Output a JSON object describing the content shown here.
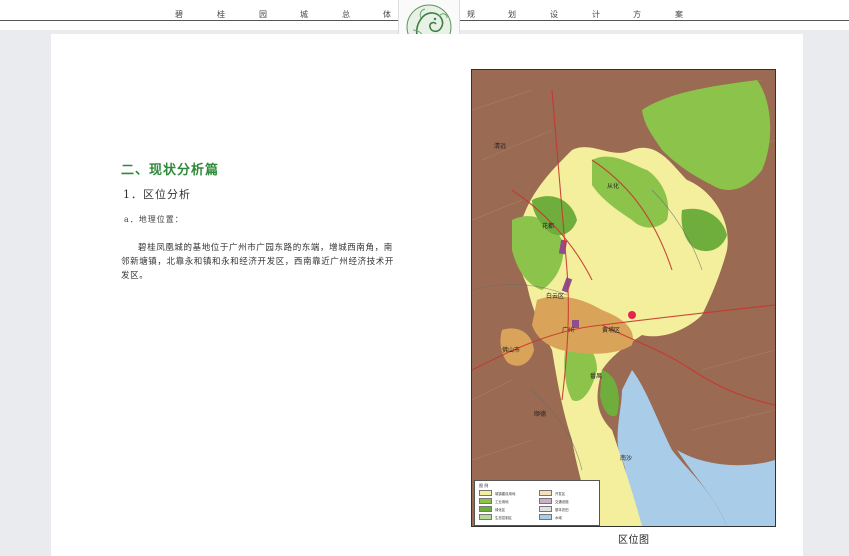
{
  "header": {
    "chars": [
      "碧",
      "桂",
      "园",
      "城",
      "总",
      "体",
      "规",
      "划",
      "设",
      "计",
      "方",
      "案"
    ],
    "emblem": "phoenix-emblem"
  },
  "content": {
    "section_title": "二、现状分析篇",
    "subsection": "1．区位分析",
    "item": "a．地理位置：",
    "paragraph": "碧桂凤凰城的基地位于广州市广园东路的东端，增城西南角，南邻新塘镇，北靠永和镇和永和经济开发区，西南靠近广州经济技术开发区。"
  },
  "map": {
    "caption": "区位图",
    "labels": [
      "清远",
      "从化",
      "花都",
      "白云区",
      "广州",
      "黄埔区",
      "佛山市",
      "番禺",
      "顺德",
      "南沙"
    ],
    "legend_title": "图 例",
    "legend_items": [
      "城镇建设用地",
      "工业用地",
      "绿化区",
      "生态控制区",
      "开发区",
      "交通设施",
      "基本农田",
      "水域"
    ],
    "colors": {
      "accent_green": "#2e8b3a",
      "map_green": "#8cc34a",
      "map_dark_green": "#6fae3c",
      "map_yellow": "#f3ef9c",
      "map_urban": "#d9a45a",
      "map_purple": "#8e4e8c",
      "map_water": "#a9cde9",
      "map_terrain": "#9a6a52"
    }
  }
}
